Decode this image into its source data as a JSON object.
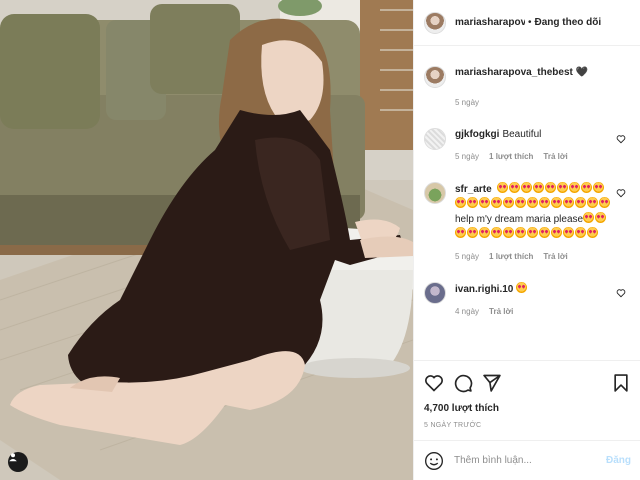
{
  "header": {
    "username": "mariasharapova_t",
    "separator": "•",
    "follow_status": "Đang theo dõi"
  },
  "caption": {
    "username": "mariasharapova_thebest",
    "emoji": "🖤",
    "time": "5 ngày"
  },
  "comments": [
    {
      "username": "gjkfogkgi",
      "text": "Beautiful",
      "time": "5 ngày",
      "likes": "1 lượt thích",
      "reply": "Trả lời"
    },
    {
      "username": "sfr_arte",
      "text": "help m'y dream maria please",
      "time": "5 ngày",
      "likes": "1 lượt thích",
      "reply": "Trả lời"
    },
    {
      "username": "ivan.righi.10",
      "text": "",
      "time": "4 ngày",
      "reply": "Trả lời"
    }
  ],
  "post": {
    "likes": "4,700 lượt thích",
    "date": "5 NGÀY TRƯỚC"
  },
  "comment_box": {
    "placeholder": "Thêm bình luận...",
    "post_label": "Đăng"
  },
  "icons": {
    "like": "heart-outline-icon",
    "comment": "comment-bubble-icon",
    "share": "paper-plane-icon",
    "save": "bookmark-icon",
    "emoji": "smiley-icon",
    "tag": "user-tag-icon"
  },
  "colors": {
    "post_button_disabled": "#b9dffc",
    "muted_text": "#8e8e8e",
    "divider": "#efefef"
  }
}
